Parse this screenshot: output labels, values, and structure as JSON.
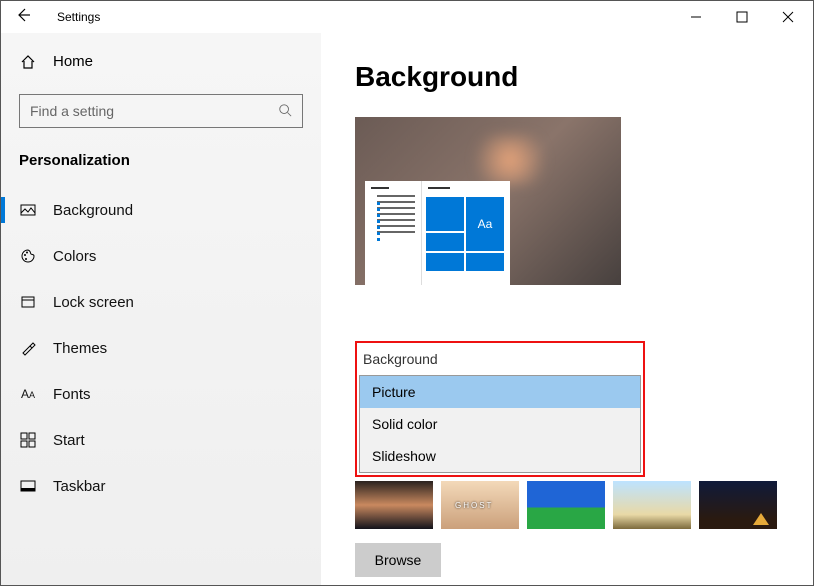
{
  "window": {
    "title": "Settings"
  },
  "sidebar": {
    "home_label": "Home",
    "search_placeholder": "Find a setting",
    "section_title": "Personalization",
    "items": [
      {
        "icon": "picture-icon",
        "label": "Background",
        "active": true
      },
      {
        "icon": "palette-icon",
        "label": "Colors"
      },
      {
        "icon": "lock-screen-icon",
        "label": "Lock screen"
      },
      {
        "icon": "themes-icon",
        "label": "Themes"
      },
      {
        "icon": "fonts-icon",
        "label": "Fonts"
      },
      {
        "icon": "start-icon",
        "label": "Start"
      },
      {
        "icon": "taskbar-icon",
        "label": "Taskbar"
      }
    ]
  },
  "main": {
    "title": "Background",
    "preview_sample_text": "Aa",
    "dropdown": {
      "label": "Background",
      "options": [
        "Picture",
        "Solid color",
        "Slideshow"
      ],
      "selected": "Picture"
    },
    "browse_label": "Browse"
  }
}
